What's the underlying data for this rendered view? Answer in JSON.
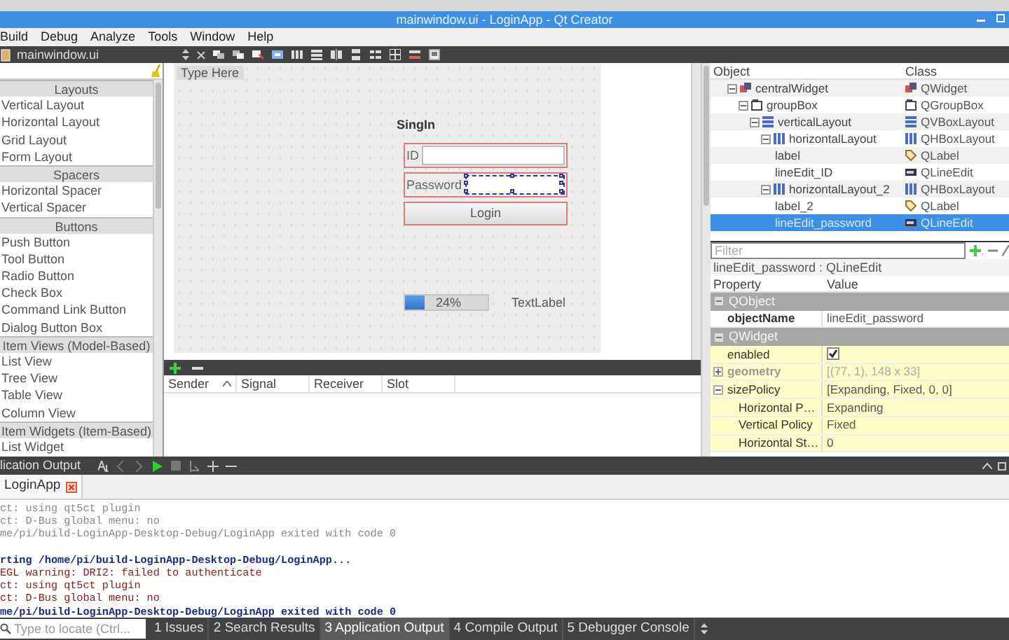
{
  "window": {
    "title": "mainwindow.ui - LoginApp - Qt Creator"
  },
  "menu": [
    "Build",
    "Debug",
    "Analyze",
    "Tools",
    "Window",
    "Help"
  ],
  "toolbar": {
    "file": "mainwindow.ui"
  },
  "widget_box": {
    "items": [
      {
        "kind": "category",
        "label": "Layouts"
      },
      {
        "kind": "widget",
        "label": "Vertical Layout"
      },
      {
        "kind": "widget",
        "label": "Horizontal Layout"
      },
      {
        "kind": "widget",
        "label": "Grid Layout"
      },
      {
        "kind": "widget",
        "label": "Form Layout"
      },
      {
        "kind": "category",
        "label": "Spacers"
      },
      {
        "kind": "widget",
        "label": "Horizontal Spacer"
      },
      {
        "kind": "widget",
        "label": "Vertical Spacer"
      },
      {
        "kind": "category",
        "label": "Buttons"
      },
      {
        "kind": "widget",
        "label": "Push Button"
      },
      {
        "kind": "widget",
        "label": "Tool Button"
      },
      {
        "kind": "widget",
        "label": "Radio Button"
      },
      {
        "kind": "widget",
        "label": "Check Box"
      },
      {
        "kind": "widget",
        "label": "Command Link Button"
      },
      {
        "kind": "widget",
        "label": "Dialog Button Box"
      },
      {
        "kind": "category",
        "label": "Item Views (Model-Based)"
      },
      {
        "kind": "widget",
        "label": "List View"
      },
      {
        "kind": "widget",
        "label": "Tree View"
      },
      {
        "kind": "widget",
        "label": "Table View"
      },
      {
        "kind": "widget",
        "label": "Column View"
      },
      {
        "kind": "category",
        "label": "Item Widgets (Item-Based)"
      },
      {
        "kind": "widget",
        "label": "List Widget"
      }
    ]
  },
  "form": {
    "menu_placeholder": "Type Here",
    "title": "SingIn",
    "rows": [
      {
        "kind": "field",
        "label": "ID",
        "selected": false
      },
      {
        "kind": "field",
        "label": "Password",
        "selected": true
      },
      {
        "kind": "button",
        "label": "Login",
        "selected": false
      }
    ],
    "progress": {
      "level": 0.24,
      "reading": "24%"
    },
    "text_label": "TextLabel"
  },
  "signal_slot": {
    "columns": [
      {
        "label": "Sender",
        "sorted": true
      },
      {
        "label": "Signal",
        "sorted": false
      },
      {
        "label": "Receiver",
        "sorted": false
      },
      {
        "label": "Slot",
        "sorted": false
      }
    ]
  },
  "object_inspector": {
    "columns": [
      "Object",
      "Class"
    ],
    "tree": [
      {
        "object": "centralWidget",
        "class": "QWidget",
        "kind": "widget",
        "selected": false,
        "expanded": true,
        "children": [
          {
            "object": "groupBox",
            "class": "QGroupBox",
            "kind": "groupbox",
            "selected": false,
            "expanded": true,
            "children": [
              {
                "object": "verticalLayout",
                "class": "QVBoxLayout",
                "kind": "layout_v",
                "selected": false,
                "expanded": true,
                "children": [
                  {
                    "object": "horizontalLayout",
                    "class": "QHBoxLayout",
                    "kind": "layout_h",
                    "selected": false,
                    "expanded": true,
                    "children": [
                      {
                        "object": "label",
                        "class": "QLabel",
                        "kind": "label",
                        "selected": false
                      },
                      {
                        "object": "lineEdit_ID",
                        "class": "QLineEdit",
                        "kind": "line_edit",
                        "selected": false
                      }
                    ]
                  },
                  {
                    "object": "horizontalLayout_2",
                    "class": "QHBoxLayout",
                    "kind": "layout_h",
                    "selected": false,
                    "expanded": true,
                    "children": [
                      {
                        "object": "label_2",
                        "class": "QLabel",
                        "kind": "label",
                        "selected": false
                      },
                      {
                        "object": "lineEdit_password",
                        "class": "QLineEdit",
                        "kind": "line_edit",
                        "selected": true
                      }
                    ]
                  }
                ]
              }
            ]
          }
        ]
      }
    ]
  },
  "property_editor": {
    "filter_placeholder": "Filter",
    "title": "lineEdit_password : QLineEdit",
    "columns": [
      "Property",
      "Value"
    ],
    "groups": [
      {
        "label": "QObject",
        "color": "#ffffff",
        "expanded": true,
        "properties": [
          {
            "kind": "text",
            "name": "objectName",
            "value": "lineEdit_password",
            "modified": true,
            "disabled": false
          }
        ]
      },
      {
        "label": "QWidget",
        "color": "#fdfdc8",
        "expanded": true,
        "properties": [
          {
            "kind": "check",
            "name": "enabled",
            "checked": true,
            "modified": false,
            "disabled": false
          },
          {
            "kind": "text",
            "name": "geometry",
            "value": "[(77, 1), 148 x 33]",
            "modified": true,
            "disabled": true,
            "expanded": false
          },
          {
            "kind": "text",
            "name": "sizePolicy",
            "value": "[Expanding, Fixed, 0, 0]",
            "modified": false,
            "disabled": false,
            "expanded": true,
            "children": [
              {
                "kind": "text",
                "name": "Horizontal P…",
                "value": "Expanding",
                "modified": false,
                "disabled": false
              },
              {
                "kind": "text",
                "name": "Vertical Policy",
                "value": "Fixed",
                "modified": false,
                "disabled": false
              },
              {
                "kind": "text",
                "name": "Horizontal St…",
                "value": "0",
                "modified": false,
                "disabled": false
              }
            ]
          }
        ]
      }
    ]
  },
  "output": {
    "pane_title": "lication Output",
    "tab": "LoginApp",
    "lines": [
      {
        "kind": "old",
        "text": "ct: using qt5ct plugin"
      },
      {
        "kind": "old",
        "text": "ct: D-Bus global menu: no"
      },
      {
        "kind": "old",
        "text": "me/pi/build-LoginApp-Desktop-Debug/LoginApp exited with code 0"
      },
      {
        "kind": "start",
        "text": "rting /home/pi/build-LoginApp-Desktop-Debug/LoginApp..."
      },
      {
        "kind": "error",
        "text": "EGL warning: DRI2: failed to authenticate"
      },
      {
        "kind": "error",
        "text": "ct: using qt5ct plugin"
      },
      {
        "kind": "error",
        "text": "ct: D-Bus global menu: no"
      },
      {
        "kind": "exit",
        "text": "me/pi/build-LoginApp-Desktop-Debug/LoginApp exited with code 0"
      }
    ]
  },
  "status_bar": {
    "locate_placeholder": "Type to locate (Ctrl...",
    "tabs": [
      {
        "label": "1 Issues",
        "selected": false
      },
      {
        "label": "2 Search Results",
        "selected": false
      },
      {
        "label": "3 Application Output",
        "selected": true
      },
      {
        "label": "4 Compile Output",
        "selected": false
      },
      {
        "label": "5 Debugger Console",
        "selected": false
      }
    ]
  }
}
